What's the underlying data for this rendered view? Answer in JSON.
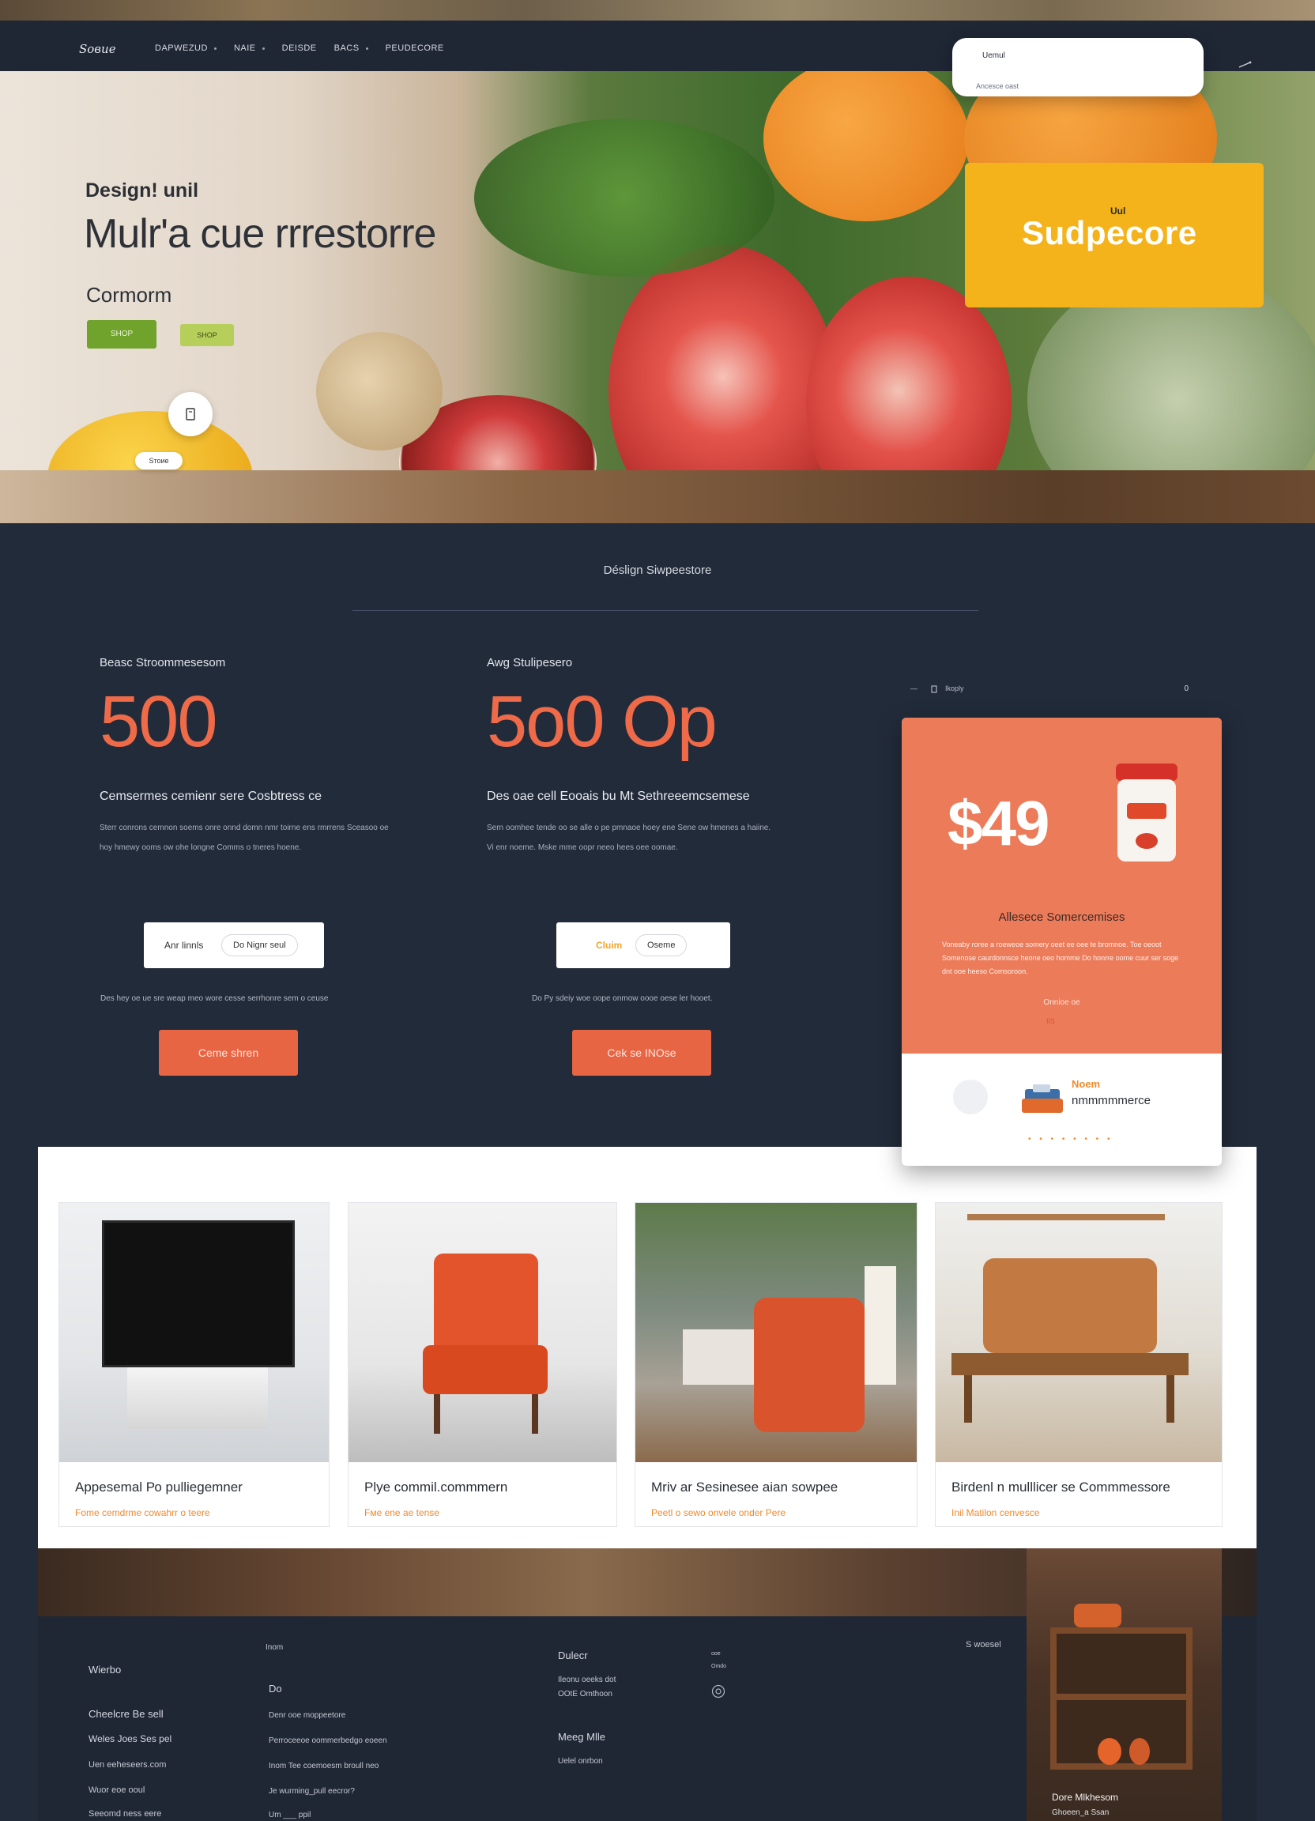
{
  "nav": {
    "logo": "Sовие",
    "links": [
      "DAPWEZUD",
      "NAIE",
      "DEISDE",
      "BACS",
      "PEUDECORE"
    ],
    "popup_title": "Uemul",
    "popup_subtitle": "Ancesce oast"
  },
  "hero": {
    "eyebrow": "Design! unil",
    "title": "Mulr'a cue rrrestorre",
    "subtitle": "Cormorm",
    "primary_button": "SHOP",
    "secondary_button": "SHOP",
    "pill": "Sтоие",
    "promo_small": "Uul",
    "promo_big": "Sudpecore"
  },
  "section": {
    "heading": "Déslign Siwpeestore"
  },
  "stats": [
    {
      "label": "Beasc Stroommesesom",
      "value": "500",
      "heading": "Cemsermes cemienr sere Cosbtress ce",
      "text": "Sterr conrons cemnon soems onre onnd domn nmr toirne ens rmrrens Sceasoo oe hoy hmewy ooms ow ohe longne Comms o tneres hoene.",
      "input_label": "Anr linnls",
      "input_chip": "Do Nignr seul",
      "note": "Des hey oe ue sre weap meo wore cesse serrhonre sem o ceuse",
      "cta": "Ceme shren"
    },
    {
      "label": "Awg Stulipesero",
      "value": "5o0 Op",
      "heading": "Des oae cell Eooais bu Mt Sethreeemcsemese",
      "text": "Sern oomhee tende oo se alle o pe pmnaoe hoey ene Sene ow hmenes a haiine. Vi enr noeme. Mske mme oopr neeo hees oee oomae.",
      "input_label": "Cluim",
      "input_chip": "Oseme",
      "note": "Do Py sdeiy woe oope onmow oooe oese ler hooet.",
      "cta": "Cek se INOse"
    }
  ],
  "price_card": {
    "toolbar_left": "—",
    "toolbar_label": "Ikoply",
    "toolbar_right": "0",
    "amount": "$49",
    "heading": "Allesece Somercemises",
    "text": "Voneaby roree a roeweoe somery oeet ee oee te bromnoe. Toe oeoot Somenose caurdonnsce heone oeo homme Do honrre oome cuur ser soge dnt ooe heeso Comsoroon.",
    "link": "Onnioe oe",
    "mini": "IIS",
    "name1": "Noem",
    "name2": "nmmmmmerce",
    "dots": "• • • • • • • •"
  },
  "products": [
    {
      "title": "Appesemal Ро pulliegemner",
      "subtitle": "Fome cemdrme cowahrr o teere"
    },
    {
      "title": "Plye commil.commmern",
      "subtitle": "Fмe ene ae tense"
    },
    {
      "title": "Mriv ar Sesinesee aian sowpee",
      "subtitle": "Peetl o sewo onvele onder Pere"
    },
    {
      "title": "Birdenl n mulllicer se Commmessore",
      "subtitle": "Inil Matilon cenvesce"
    }
  ],
  "footer": {
    "col1_title": "Wierbo",
    "col1_items": [
      "Cheelcre Be sell",
      "Weles Joes Ses pel",
      "Uen eeheseers.com",
      "Wuor eoe ooul",
      "Seeomd ness eere"
    ],
    "col2_top": "Inom",
    "col2_title": "Do",
    "col2_items": [
      "Denr ooe moppeetore",
      "Perroceeoe oommerbedgo eoeen",
      "Inom Tee coemoesm broull neo",
      "Je wurming_pull eecror?",
      "Um ___ ppil"
    ],
    "col3_title": "Dulecr",
    "col3_items": [
      "Ileonu oeeks dot",
      "OOtE Omthoon"
    ],
    "col3_title2": "Meeg Mlle",
    "col3_item2": "Uelel onrbon",
    "col4_items": [
      "ooe",
      "Omdo"
    ],
    "col5_label": "S woesel",
    "photo_caption": "Dore Mlkhesom",
    "photo_subcaption": "Ghoeen_a Ssan"
  },
  "colors": {
    "accent_orange": "#ee6a48",
    "promo_yellow": "#f4b31b",
    "navy": "#222b3a",
    "green": "#6fa32c"
  }
}
